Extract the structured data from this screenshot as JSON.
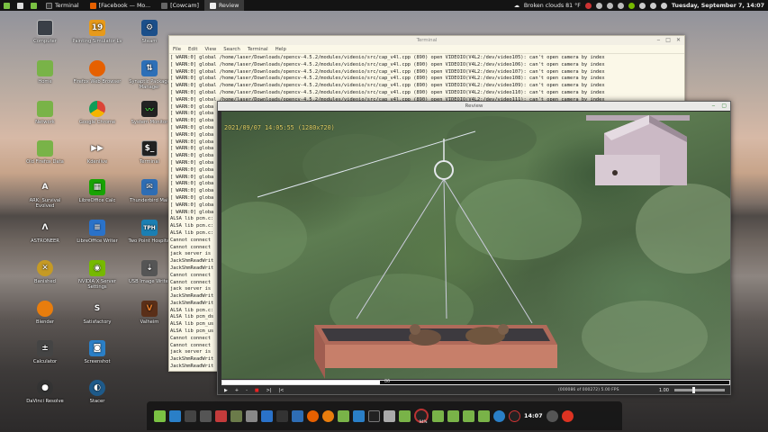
{
  "top_panel": {
    "tasks": [
      {
        "label": "Terminal"
      },
      {
        "label": "[Facebook — Mo..."
      },
      {
        "label": "[Cowcam]"
      },
      {
        "label": "Review"
      }
    ],
    "weather": "Broken clouds 81 °F",
    "datetime": "Tuesday, September  7, 14:07"
  },
  "desktop_icons": [
    {
      "label": "Computer"
    },
    {
      "label": "Painting Simulator Lv"
    },
    {
      "label": "Steam"
    },
    {
      "label": "Home"
    },
    {
      "label": "Firefox Web Browser"
    },
    {
      "label": "Synaptic Package Manager"
    },
    {
      "label": "Network"
    },
    {
      "label": "Google Chrome"
    },
    {
      "label": "System Monitor"
    },
    {
      "label": "Old Firefox Data"
    },
    {
      "label": "Kdenlive"
    },
    {
      "label": "Terminal"
    },
    {
      "label": "ARK: Survival Evolved"
    },
    {
      "label": "LibreOffice Calc"
    },
    {
      "label": "Thunderbird Mail"
    },
    {
      "label": "ASTRONEER"
    },
    {
      "label": "LibreOffice Writer"
    },
    {
      "label": "Two Point Hospital"
    },
    {
      "label": "Banished"
    },
    {
      "label": "NVIDIA X Server Settings"
    },
    {
      "label": "USB Image Writer"
    },
    {
      "label": "Blender"
    },
    {
      "label": "Satisfactory"
    },
    {
      "label": "Valheim"
    },
    {
      "label": "Calculator"
    },
    {
      "label": "Screenshot"
    },
    {
      "label": "DaVinci Resolve"
    },
    {
      "label": "Stacer"
    }
  ],
  "terminal": {
    "title": "Terminal",
    "menu": [
      "File",
      "Edit",
      "View",
      "Search",
      "Terminal",
      "Help"
    ],
    "lines": [
      "[ WARN:0] global /home/laser/Downloads/opencv-4.5.2/modules/videoio/src/cap_v4l.cpp (890) open VIDEOIO(V4L2:/dev/video105): can't open camera by index",
      "[ WARN:0] global /home/laser/Downloads/opencv-4.5.2/modules/videoio/src/cap_v4l.cpp (890) open VIDEOIO(V4L2:/dev/video106): can't open camera by index",
      "[ WARN:0] global /home/laser/Downloads/opencv-4.5.2/modules/videoio/src/cap_v4l.cpp (890) open VIDEOIO(V4L2:/dev/video107): can't open camera by index",
      "[ WARN:0] global /home/laser/Downloads/opencv-4.5.2/modules/videoio/src/cap_v4l.cpp (890) open VIDEOIO(V4L2:/dev/video108): can't open camera by index",
      "[ WARN:0] global /home/laser/Downloads/opencv-4.5.2/modules/videoio/src/cap_v4l.cpp (890) open VIDEOIO(V4L2:/dev/video109): can't open camera by index",
      "[ WARN:0] global /home/laser/Downloads/opencv-4.5.2/modules/videoio/src/cap_v4l.cpp (890) open VIDEOIO(V4L2:/dev/video110): can't open camera by index",
      "[ WARN:0] global /home/laser/Downloads/opencv-4.5.2/modules/videoio/src/cap_v4l.cpp (890) open VIDEOIO(V4L2:/dev/video111): can't open camera by index",
      "[ WARN:0] globa",
      "[ WARN:0] globa",
      "[ WARN:0] globa",
      "[ WARN:0] globa",
      "[ WARN:0] globa",
      "[ WARN:0] globa",
      "[ WARN:0] globa",
      "[ WARN:0] globa",
      "[ WARN:0] globa",
      "[ WARN:0] globa",
      "[ WARN:0] globa",
      "[ WARN:0] globa",
      "[ WARN:0] globa",
      "[ WARN:0] globa",
      "[ WARN:0] globa",
      "[ WARN:0] globa",
      "ALSA lib pcm.c:",
      "ALSA lib pcm.c:",
      "ALSA lib pcm.c:",
      "Cannot connect",
      "Cannot connect",
      "jack server is",
      "JackShmReadWrit",
      "JackShmReadWrit",
      "Cannot connect",
      "Cannot connect",
      "jack server is",
      "JackShmReadWrit",
      "JackShmReadWrit",
      "ALSA lib pcm.c:",
      "ALSA lib pcm_ds",
      "ALSA lib pcm_us",
      "ALSA lib pcm_us",
      "Cannot connect",
      "Cannot connect",
      "jack server is",
      "JackShmReadWrit",
      "JackShmReadWrit"
    ]
  },
  "review": {
    "title": "Review",
    "timestamp": "2021/09/07 14:05:55 (1280x720)",
    "seek_label": "86",
    "seek_progress": 0.31,
    "frame_info": "(000086 of 000272)  5.00 FPS",
    "speed": "1.00",
    "controls": [
      "▶",
      "+",
      "-",
      "■",
      ">|",
      "|<"
    ]
  },
  "dock": {
    "clock": "14:07",
    "cpu": "94%"
  },
  "colors": {
    "panel_bg": "#141414",
    "terminal_bg": "#fbf8e8",
    "timestamp": "#e7d86a"
  }
}
